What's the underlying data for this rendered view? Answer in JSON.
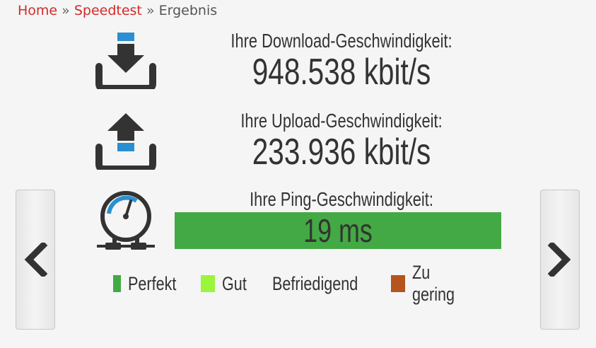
{
  "breadcrumb": {
    "home": "Home",
    "sep1": "»",
    "speedtest": "Speedtest",
    "sep2": "»",
    "current": "Ergebnis"
  },
  "download": {
    "label": "Ihre Download-Geschwindigkeit:",
    "value": "948.538 kbit/s",
    "icon": "download-icon"
  },
  "upload": {
    "label": "Ihre Upload-Geschwindigkeit:",
    "value": "233.936 kbit/s",
    "icon": "upload-icon"
  },
  "ping": {
    "label": "Ihre Ping-Geschwindigkeit:",
    "value": "19 ms",
    "icon": "gauge-icon",
    "color": "#43a944"
  },
  "nav": {
    "prev_icon": "chevron-left-icon",
    "next_icon": "chevron-right-icon"
  },
  "legend": [
    {
      "label": "Perfekt",
      "color": "#43a944"
    },
    {
      "label": "Gut",
      "color": "#9bf53a"
    },
    {
      "label": "Befriedigend",
      "color": "#fba422"
    },
    {
      "label": "Zu gering",
      "color": "#b4541e"
    }
  ]
}
